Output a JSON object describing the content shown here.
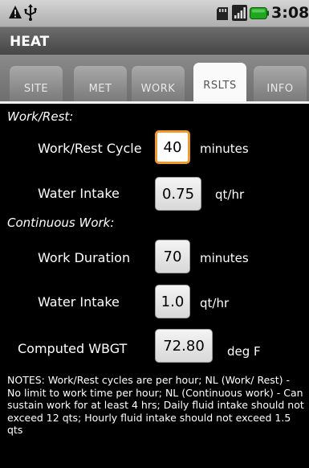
{
  "status_bar": {
    "time": "3:08 PM",
    "icons": [
      "warning-icon",
      "usb-icon",
      "sdcard-icon",
      "signal-icon",
      "battery-icon"
    ]
  },
  "app": {
    "title": "HEAT"
  },
  "tabs": [
    {
      "label": "SITE",
      "selected": false
    },
    {
      "label": "MET",
      "selected": false
    },
    {
      "label": "WORK",
      "selected": false
    },
    {
      "label": "RSLTS",
      "selected": true
    },
    {
      "label": "INFO",
      "selected": false
    }
  ],
  "work_rest": {
    "section_label": "Work/Rest:",
    "cycle_label": "Work/Rest Cycle",
    "cycle_value": "40",
    "cycle_unit": "minutes",
    "water_label": "Water Intake",
    "water_value": "0.75",
    "water_unit": "qt/hr"
  },
  "continuous": {
    "section_label": "Continuous Work:",
    "duration_label": "Work Duration",
    "duration_value": "70",
    "duration_unit": "minutes",
    "water_label": "Water Intake",
    "water_value": "1.0",
    "water_unit": "qt/hr"
  },
  "wbgt": {
    "label": "Computed WBGT",
    "value": "72.80",
    "unit": "deg F"
  },
  "notes": "NOTES: Work/Rest cycles are per hour; NL (Work/ Rest) - No limit to work time per hour; NL (Continuous work) - Can sustain work for at least 4 hrs; Daily fluid intake should not exceed 12 qts; Hourly fluid intake should not exceed 1.5 qts",
  "colors": {
    "background": "#000000",
    "focus_border": "#f0972d",
    "tab_selected": "#fafafa"
  }
}
